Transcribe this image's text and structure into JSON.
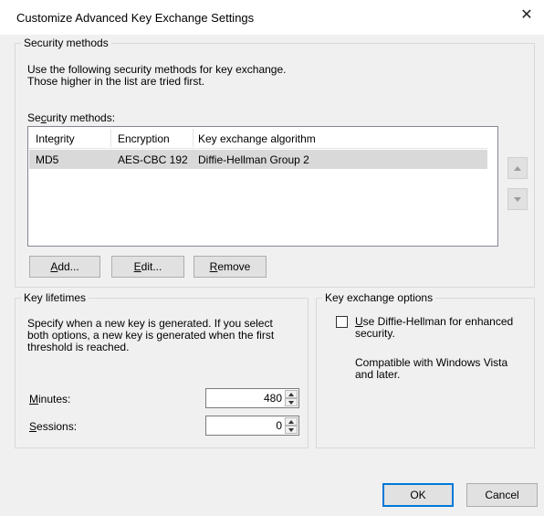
{
  "window": {
    "title": "Customize Advanced Key Exchange Settings",
    "close_glyph": "✕"
  },
  "security_methods": {
    "group_title": "Security methods",
    "description_line1": "Use the following security methods for key exchange.",
    "description_line2": "Those higher in the list are tried first.",
    "list_label_pre": "Se",
    "list_label_ul": "c",
    "list_label_post": "urity methods:",
    "columns": [
      "Integrity",
      "Encryption",
      "Key exchange algorithm"
    ],
    "rows": [
      {
        "integrity": "MD5",
        "encryption": "AES-CBC 192",
        "algorithm": "Diffie-Hellman Group 2"
      }
    ],
    "buttons": {
      "add_ul": "A",
      "add_rest": "dd...",
      "edit_ul": "E",
      "edit_rest": "dit...",
      "remove_ul": "R",
      "remove_rest": "emove"
    },
    "move_up_icon": "arrow-up-icon",
    "move_down_icon": "arrow-down-icon"
  },
  "key_lifetimes": {
    "group_title": "Key lifetimes",
    "description_line1": "Specify when a new key is generated. If you select",
    "description_line2": "both options, a new key is generated when the first",
    "description_line3": "threshold is reached.",
    "minutes_ul": "M",
    "minutes_rest": "inutes:",
    "minutes_value": "480",
    "sessions_ul": "S",
    "sessions_rest": "essions:",
    "sessions_value": "0"
  },
  "key_exchange_options": {
    "group_title": "Key exchange options",
    "checkbox_ul": "U",
    "checkbox_line1_rest": "se Diffie-Hellman for enhanced",
    "checkbox_line2": "security.",
    "note_line1": "Compatible with Windows Vista",
    "note_line2": "and later.",
    "checked": false
  },
  "footer": {
    "ok_label": "OK",
    "cancel_label": "Cancel"
  },
  "colors": {
    "accent": "#0078d7",
    "selected_row": "#d9d9d9",
    "dialog_bg": "#f0f0f0"
  }
}
